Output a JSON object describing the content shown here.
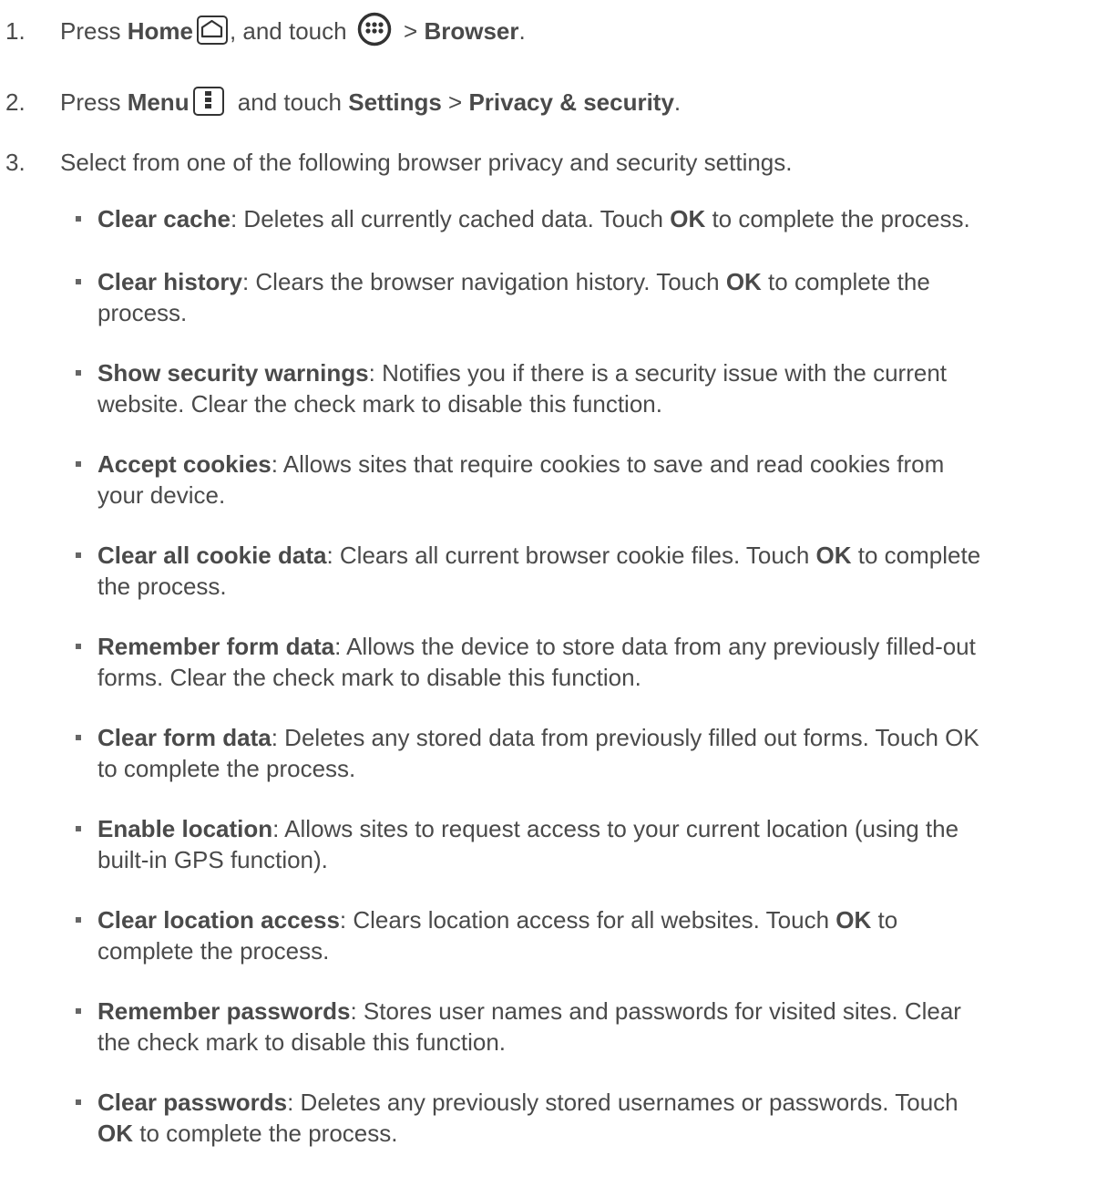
{
  "steps": [
    {
      "number": "1.",
      "press": "Press ",
      "home_label": "Home",
      "home_icon": "home-icon",
      "and_touch": ", and touch ",
      "apps_icon": "apps-icon",
      "gt": " > ",
      "browser_label": "Browser",
      "end": "."
    },
    {
      "number": "2.",
      "press": "Press ",
      "menu_label": "Menu",
      "menu_icon": "menu-icon",
      "and_touch": " and touch ",
      "settings_label": "Settings",
      "gt": " > ",
      "privacy_label": "Privacy & security",
      "end": "."
    },
    {
      "number": "3.",
      "text": "Select from one of the following browser privacy and security settings."
    }
  ],
  "settings": [
    {
      "term": "Clear cache",
      "line1": ": Deletes all currently cached data. Touch ",
      "ok": "OK",
      "line1_end": " to complete the process.",
      "line2_ok": "",
      "line2": ""
    },
    {
      "term": "Clear history",
      "line1": ": Clears the browser navigation history. Touch ",
      "ok": "OK",
      "line1_end": " to complete the",
      "line2_ok": "",
      "line2": "process."
    },
    {
      "term": "Show security warnings",
      "line1": ": Notifies you if there is a security issue with the current",
      "ok": "",
      "line1_end": "",
      "line2_ok": "",
      "line2": "website. Clear the check mark to disable this function."
    },
    {
      "term": "Accept cookies",
      "line1": ": Allows sites that require cookies to save and read cookies from",
      "ok": "",
      "line1_end": "",
      "line2_ok": "",
      "line2": "your device."
    },
    {
      "term": "Clear all cookie data",
      "line1": ": Clears all current browser cookie files. Touch ",
      "ok": "OK",
      "line1_end": " to complete",
      "line2_ok": "",
      "line2": "the process."
    },
    {
      "term": "Remember form data",
      "line1": ": Allows the device to store data from any previously filled-out",
      "ok": "",
      "line1_end": "",
      "line2_ok": "",
      "line2": "forms. Clear the check mark to disable this function."
    },
    {
      "term": "Clear form data",
      "line1": ": Deletes any stored data from previously filled out forms. Touch OK",
      "ok": "",
      "line1_end": "",
      "line2_ok": "",
      "line2": "to complete the process."
    },
    {
      "term": "Enable location",
      "line1": ": Allows sites to request access to your current location (using the",
      "ok": "",
      "line1_end": "",
      "line2_ok": "",
      "line2": "built-in GPS function)."
    },
    {
      "term": "Clear location access",
      "line1": ": Clears location access for all websites. Touch ",
      "ok": "OK",
      "line1_end": " to",
      "line2_ok": "",
      "line2": "complete the process."
    },
    {
      "term": "Remember passwords",
      "line1": ": Stores user names and passwords for visited sites. Clear",
      "ok": "",
      "line1_end": "",
      "line2_ok": "",
      "line2": "the check mark to disable this function."
    },
    {
      "term": "Clear passwords",
      "line1": ": Deletes any previously stored usernames or passwords. Touch",
      "ok": "",
      "line1_end": "",
      "line2_ok": "OK",
      "line2": " to complete the process."
    }
  ]
}
